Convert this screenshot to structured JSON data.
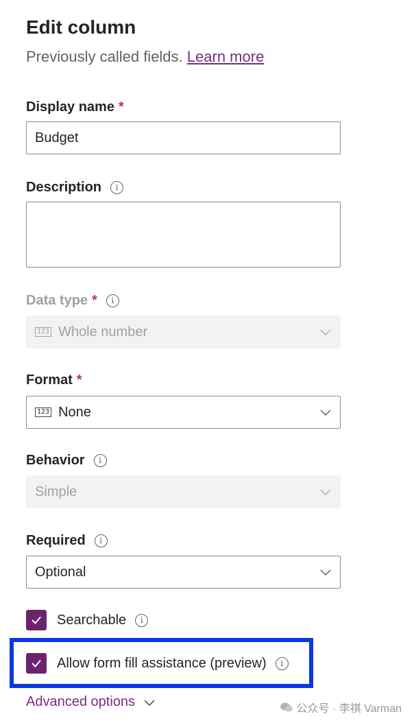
{
  "header": {
    "title": "Edit column",
    "subtitle": "Previously called fields.",
    "learn_more": "Learn more"
  },
  "fields": {
    "display_name": {
      "label": "Display name",
      "required_mark": "*",
      "value": "Budget"
    },
    "description": {
      "label": "Description",
      "value": ""
    },
    "data_type": {
      "label": "Data type",
      "required_mark": "*",
      "value": "Whole number",
      "icon": "123"
    },
    "format": {
      "label": "Format",
      "required_mark": "*",
      "value": "None",
      "icon": "123"
    },
    "behavior": {
      "label": "Behavior",
      "value": "Simple"
    },
    "required": {
      "label": "Required",
      "value": "Optional"
    }
  },
  "checkboxes": {
    "searchable": {
      "label": "Searchable",
      "checked": true
    },
    "form_fill": {
      "label": "Allow form fill assistance (preview)",
      "checked": true
    }
  },
  "advanced_options": "Advanced options",
  "watermark": "公众号 · 李祺 Varman",
  "colors": {
    "accent": "#6b2370",
    "link": "#7a2d80",
    "highlight": "#0a38e4",
    "required": "#c4314b"
  }
}
